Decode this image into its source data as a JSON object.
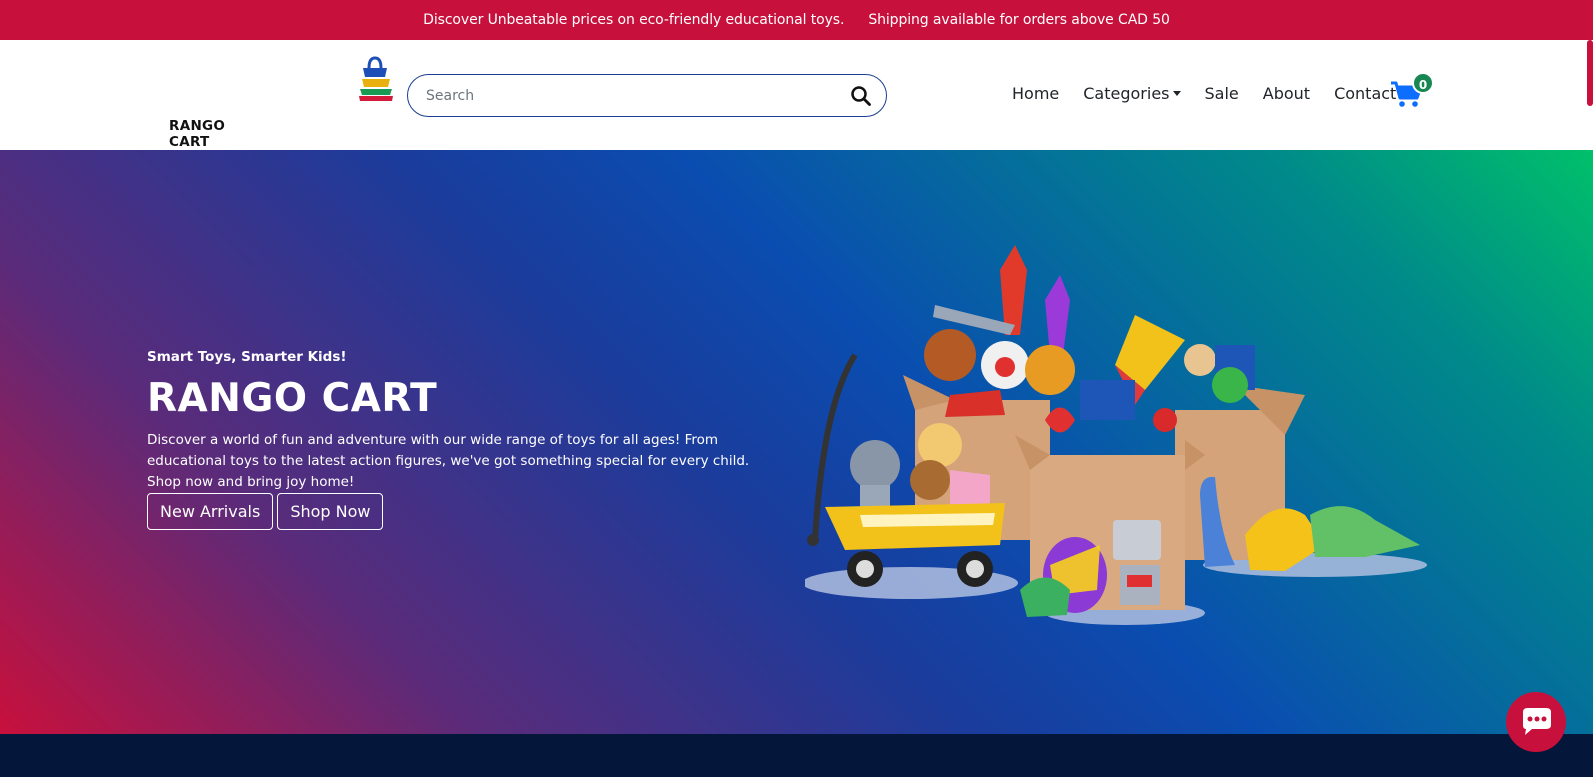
{
  "announcement": {
    "message_1": "Discover Unbeatable prices on eco-friendly educational toys.",
    "message_2": "Shipping available for orders above CAD 50"
  },
  "brand": {
    "name": "RANGO CART",
    "colors": {
      "primary": "#c8103c",
      "navy": "#1b3f8f",
      "cart_blue": "#0d6efd",
      "badge_green": "#198754"
    }
  },
  "search": {
    "placeholder": "Search",
    "value": "",
    "icon": "search-icon"
  },
  "nav": {
    "items": [
      {
        "label": "Home"
      },
      {
        "label": "Categories",
        "has_dropdown": true
      },
      {
        "label": "Sale"
      },
      {
        "label": "About"
      },
      {
        "label": "Contact"
      }
    ],
    "cart": {
      "icon": "cart-icon",
      "count": "0"
    }
  },
  "hero": {
    "tagline": "Smart Toys, Smarter Kids!",
    "title": "RANGO CART",
    "description": "Discover a world of fun and adventure with our wide range of toys for all ages! From educational toys to the latest action figures, we've got something special for every child. Shop now and bring joy home!",
    "buttons": {
      "new_arrivals": "New Arrivals",
      "shop_now": "Shop Now"
    },
    "image": "toy-boxes-illustration"
  },
  "chat": {
    "icon": "chat-bubble-icon"
  }
}
